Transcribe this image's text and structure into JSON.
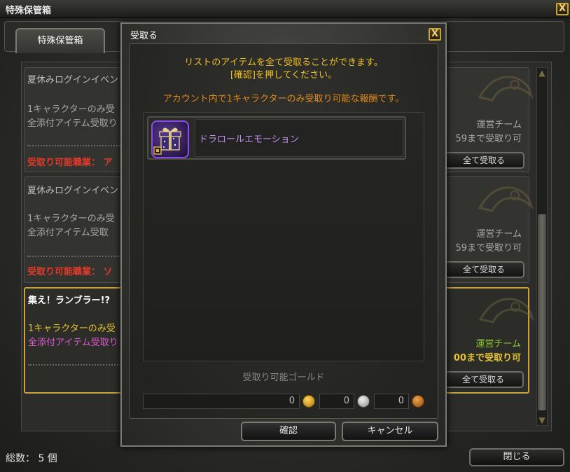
{
  "window": {
    "title": "特殊保管箱",
    "close_glyph": "X"
  },
  "tabs": [
    {
      "label": "特殊保管箱"
    }
  ],
  "list": {
    "cards": [
      {
        "title": "夏休みログインイベン",
        "line1": "1キャラクターのみ受",
        "line2": "全添付アイテム受取り",
        "red": "受取り可能職業： ア",
        "sender": "運営チーム",
        "deadline": "59まで受取り可",
        "button": "全て受取る"
      },
      {
        "title": "夏休みログインイベン",
        "line1": "1キャラクターのみ受",
        "line2": "全添付アイテム受取",
        "red": "受取り可能職業： ソ",
        "sender": "運営チーム",
        "deadline": "59まで受取り可",
        "button": "全て受取る"
      },
      {
        "title": "集え！ランブラー!?",
        "line1": "1キャラクターのみ受",
        "line2": "全添付アイテム受取り",
        "sender": "運営チーム",
        "deadline": "00まで受取り可",
        "button": "全て受取る"
      }
    ]
  },
  "footer": {
    "total_label": "総数： 5 個",
    "close_label": "閉じる"
  },
  "dialog": {
    "title": "受取る",
    "close_glyph": "X",
    "message_1": "リストのアイテムを全て受取ることができます。",
    "message_2": "[確認]を押してください。",
    "message_3": "アカウント内で1キャラクターのみ受取り可能な報酬です。",
    "items": [
      {
        "name": "ドラロールエモーション",
        "icon": "gift-box-icon"
      }
    ],
    "gold": {
      "label": "受取り可能ゴールド",
      "gold": "0",
      "silver": "0",
      "copper": "0"
    },
    "confirm_label": "確認",
    "cancel_label": "キャンセル"
  },
  "colors": {
    "accent_gold": "#c9a33c",
    "message_yellow": "#f0c020",
    "message_orange": "#e08a18",
    "item_purple": "#c68ff5",
    "required_red": "#e03a2a",
    "sender_green": "#8fc92d"
  }
}
